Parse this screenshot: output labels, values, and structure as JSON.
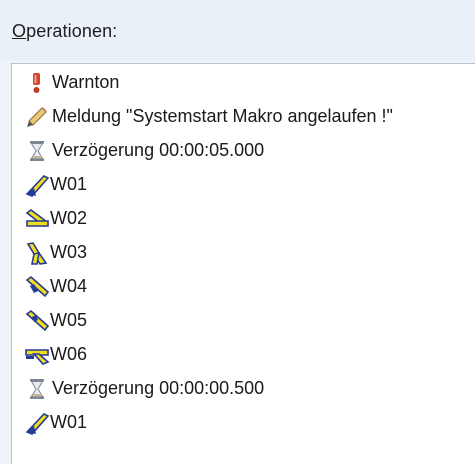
{
  "header": {
    "label_underlined": "O",
    "label_rest": "perationen:"
  },
  "operations": [
    {
      "icon": "alarm-icon",
      "text": "Warnton"
    },
    {
      "icon": "pencil-icon",
      "text": "Meldung \"Systemstart Makro angelaufen !\""
    },
    {
      "icon": "hourglass-icon",
      "text": "Verzögerung 00:00:05.000"
    },
    {
      "icon": "switch-icon",
      "text": "W01"
    },
    {
      "icon": "switch-icon",
      "text": "W02"
    },
    {
      "icon": "switch-icon",
      "text": "W03"
    },
    {
      "icon": "switch-icon",
      "text": "W04"
    },
    {
      "icon": "switch-icon",
      "text": "W05"
    },
    {
      "icon": "switch-icon",
      "text": "W06"
    },
    {
      "icon": "hourglass-icon",
      "text": "Verzögerung 00:00:00.500"
    },
    {
      "icon": "switch-icon",
      "text": "W01"
    }
  ],
  "colors": {
    "switch_yellow": "#f2dd1d",
    "switch_blue": "#233d96",
    "alarm_red": "#d4462b"
  }
}
